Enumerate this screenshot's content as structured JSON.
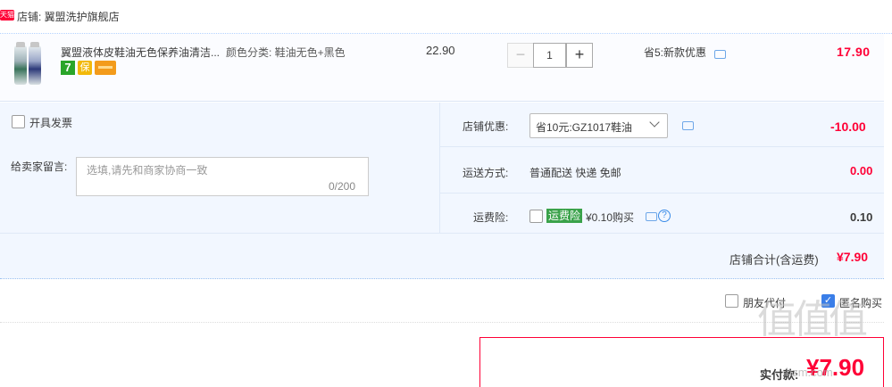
{
  "shop": {
    "badge": "天猫",
    "label": "店铺: 翼盟洗护旗舰店"
  },
  "item": {
    "title": "翼盟液体皮鞋油无色保养油清洁...",
    "sku": "颜色分类: 鞋油无色+黑色",
    "icons": [
      "seven-day-return-icon",
      "guarantee-icon",
      "credit-card-icon"
    ],
    "icon_seven_text": "7",
    "icon_guarantee_text": "保",
    "price": "22.90",
    "quantity": "1",
    "minus": "−",
    "plus": "+",
    "promo": "省5:新款优惠",
    "subtotal": "17.90"
  },
  "options": {
    "invoice_label": "开具发票",
    "message_label": "给卖家留言:",
    "message_placeholder": "选填,请先和商家协商一致",
    "message_count": "0/200",
    "shop_discount_label": "店铺优惠:",
    "shop_discount_selected": "省10元:GZ1017鞋油",
    "shop_discount_value": "-10.00",
    "delivery_label": "运送方式:",
    "delivery_text": "普通配送 快递 免邮",
    "delivery_value": "0.00",
    "insurance_label": "运费险:",
    "insurance_tag": "运费险",
    "insurance_price": "¥0.10购买",
    "insurance_value": "0.10",
    "help_symbol": "?"
  },
  "totals": {
    "shop_total_label": "店铺合计(含运费)",
    "shop_total_value": "¥7.90"
  },
  "footer": {
    "friend_pay_label": "朋友代付",
    "anonymous_label": "匿名购买",
    "anonymous_checked": "✓",
    "pay_label": "实付款:",
    "pay_value": "¥7.90"
  },
  "watermark": {
    "glyphs": "值值值",
    "domain": "hzm.com"
  },
  "colors": {
    "accent_red": "#ff0036",
    "border_blue": "#b2d1ff",
    "panel_bg": "#f2f7ff",
    "check_blue": "#3a7ee8",
    "insurance_green": "#3aa24a"
  }
}
